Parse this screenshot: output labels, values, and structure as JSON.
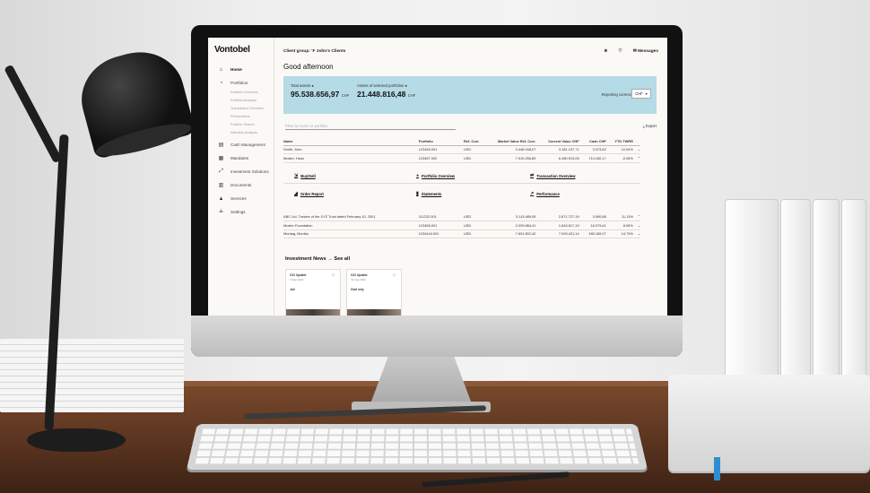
{
  "colors": {
    "banner": "#b5dbe6",
    "screen_bg": "#fbf9f6",
    "desk": "#6b3f26",
    "lamp": "#1d1d1d"
  },
  "app": {
    "logo": "Vontobel",
    "client_group": "Client group: ‘F John’s Clients",
    "messages": "Messages",
    "greeting": "Good afternoon"
  },
  "sidebar": {
    "items": [
      {
        "label": "Home",
        "icon": "home-icon",
        "glyph": "⌂"
      },
      {
        "label": "Portfolios",
        "icon": "portfolio-icon",
        "glyph": "◔"
      }
    ],
    "subitems": [
      "Portfolio Overview",
      "Portfolio Analysis",
      "Transaction Overview",
      "Performance",
      "Position Search",
      "Attention Analysis"
    ],
    "more_items": [
      {
        "label": "Cash Management",
        "icon": "cash-icon",
        "glyph": "▤"
      },
      {
        "label": "Mandates",
        "icon": "mandate-icon",
        "glyph": "▦"
      },
      {
        "label": "Investment Solutions",
        "icon": "solutions-icon",
        "glyph": "⤢"
      },
      {
        "label": "Documents",
        "icon": "documents-icon",
        "glyph": "▥"
      },
      {
        "label": "Services",
        "icon": "services-icon",
        "glyph": "▲"
      },
      {
        "label": "Settings",
        "icon": "settings-icon",
        "glyph": "≟"
      }
    ]
  },
  "banner": {
    "total_assets_label": "Total assets",
    "total_assets_value": "95.538.656,97",
    "total_assets_currency": "CHF",
    "selected_label": "Assets of selected portfolios",
    "selected_value": "21.448.816,48",
    "selected_currency": "CHF",
    "reporting_label": "Reporting currency",
    "reporting_value": "CHF"
  },
  "search": {
    "placeholder": "Filter by name or portfolio",
    "export": "Export"
  },
  "table": {
    "headers": [
      "Name",
      "Portfolio",
      "Ref. Curr.",
      "Market Value Ref. Curr.",
      "Current Value CHF",
      "Cash CHF",
      "YTD TWRR"
    ],
    "rows": [
      [
        "Smith, John",
        "123456.001",
        "USD",
        "3.448.948,07",
        "3.181.107,71",
        "3.373,62",
        "12,04%"
      ],
      [
        "Muster, Hans",
        "123457.002",
        "USD",
        "7.010.256,89",
        "6.480.913,05",
        "714.150,17",
        "-0,06%"
      ]
    ],
    "rows2": [
      [
        "ABC Ltd. Trustee of the XYZ Trust dated February 10, 2001",
        "111222.001",
        "USD",
        "3.113.489,05",
        "2.871.727,19",
        "3.090,86",
        "11,13%"
      ],
      [
        "Muster Foundation",
        "123456.001",
        "USD",
        "2.009.884,41",
        "1.843.617,19",
        "18.075,61",
        "8,06%"
      ],
      [
        "Montag, Monika",
        "1234444.001",
        "USD",
        "7.691.802,42",
        "7.093.421,14",
        "185.189,07",
        "14,73%"
      ]
    ]
  },
  "actions": {
    "buy_sell": "Buy/Sell",
    "portfolio_overview": "Portfolio Overview",
    "transaction_overview": "Transaction Overview",
    "order_report": "Order Report",
    "statements": "Statements",
    "performance": "Performance"
  },
  "news": {
    "title": "Investment News",
    "link": "See all",
    "cards": [
      {
        "title": "CIO Update",
        "date": "4 Sep 2023",
        "tag": "Job"
      },
      {
        "title": "CIO Update",
        "date": "31 Aug 2023",
        "tag": "Gold only"
      }
    ]
  }
}
